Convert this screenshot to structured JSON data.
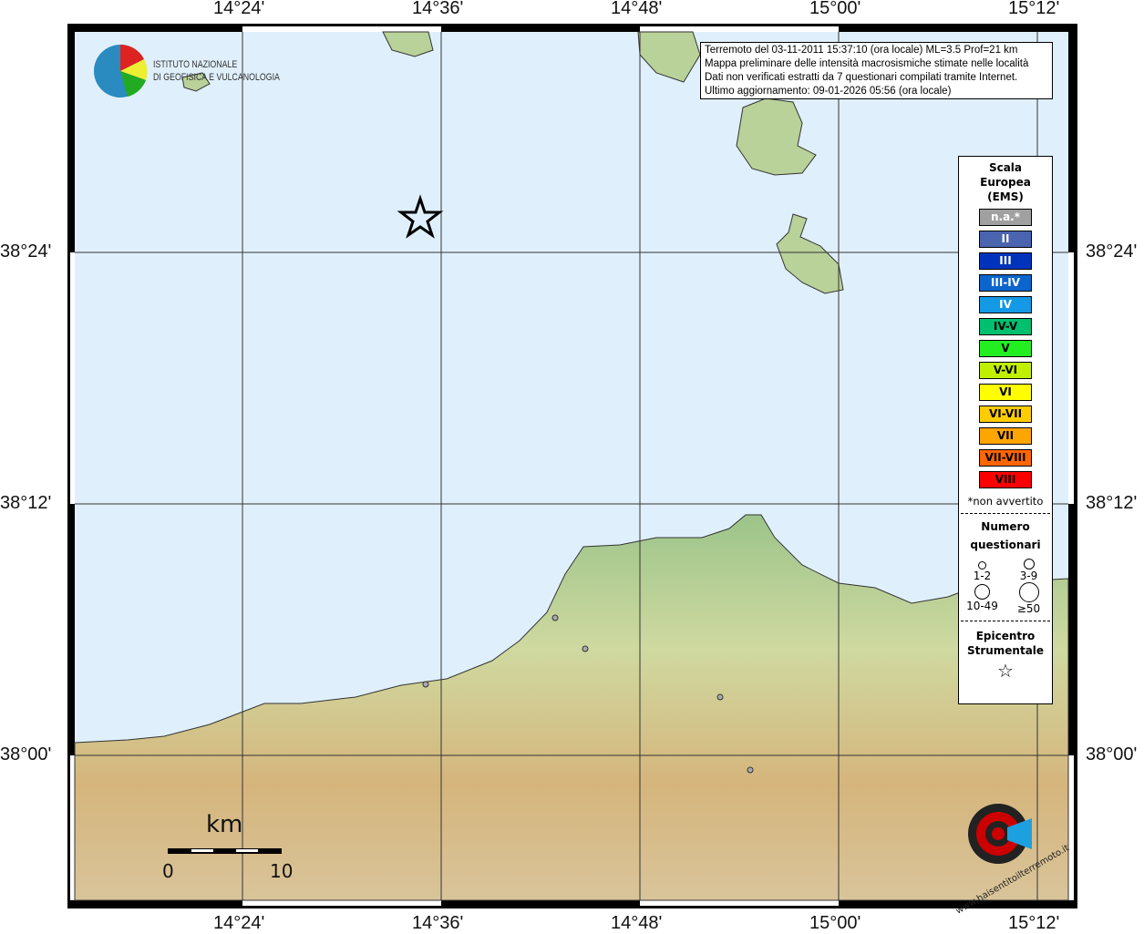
{
  "info": {
    "lines": [
      "Terremoto del 03-11-2011 15:37:10 (ora locale) ML=3.5 Prof=21 km",
      "Mappa preliminare delle intensità macrosismiche stimate nelle località",
      "Dati non verificati estratti da 7 questionari compilati tramite Internet.",
      "Ultimo aggiornamento: 09-01-2026 05:56 (ora locale)"
    ]
  },
  "logo": {
    "line1": "ISTITUTO NAZIONALE",
    "line2": "DI GEOFISICA E VULCANOLOGIA",
    "site": "www.haisentitoilterremoto.it"
  },
  "axes": {
    "lon": [
      "14°24'",
      "14°36'",
      "14°48'",
      "15°00'",
      "15°12'"
    ],
    "lat": [
      "38°24'",
      "38°12'",
      "38°00'"
    ]
  },
  "legend": {
    "title": [
      "Scala",
      "Europea",
      "(EMS)"
    ],
    "classes": [
      {
        "label": "n.a.*",
        "color": "#a0a0a0",
        "text": "#fff"
      },
      {
        "label": "II",
        "color": "#4a64b0",
        "text": "#fff"
      },
      {
        "label": "III",
        "color": "#0033bb",
        "text": "#fff"
      },
      {
        "label": "III-IV",
        "color": "#0a66cc",
        "text": "#fff"
      },
      {
        "label": "IV",
        "color": "#1399e6",
        "text": "#fff"
      },
      {
        "label": "IV-V",
        "color": "#00c070",
        "text": "#000"
      },
      {
        "label": "V",
        "color": "#22ee22",
        "text": "#000"
      },
      {
        "label": "V-VI",
        "color": "#c0f000",
        "text": "#000"
      },
      {
        "label": "VI",
        "color": "#ffff00",
        "text": "#000"
      },
      {
        "label": "VI-VII",
        "color": "#ffcc00",
        "text": "#000"
      },
      {
        "label": "VII",
        "color": "#ffa500",
        "text": "#000"
      },
      {
        "label": "VII-VIII",
        "color": "#ff6600",
        "text": "#000"
      },
      {
        "label": "VIII",
        "color": "#ff0000",
        "text": "#000"
      }
    ],
    "note": "*non avvertito",
    "count_title": [
      "Numero",
      "questionari"
    ],
    "counts": [
      "1-2",
      "3-9",
      "10-49",
      "≥50"
    ],
    "epi_title": [
      "Epicentro",
      "Strumentale"
    ]
  },
  "scale": {
    "unit": "km",
    "min": "0",
    "max": "10"
  }
}
